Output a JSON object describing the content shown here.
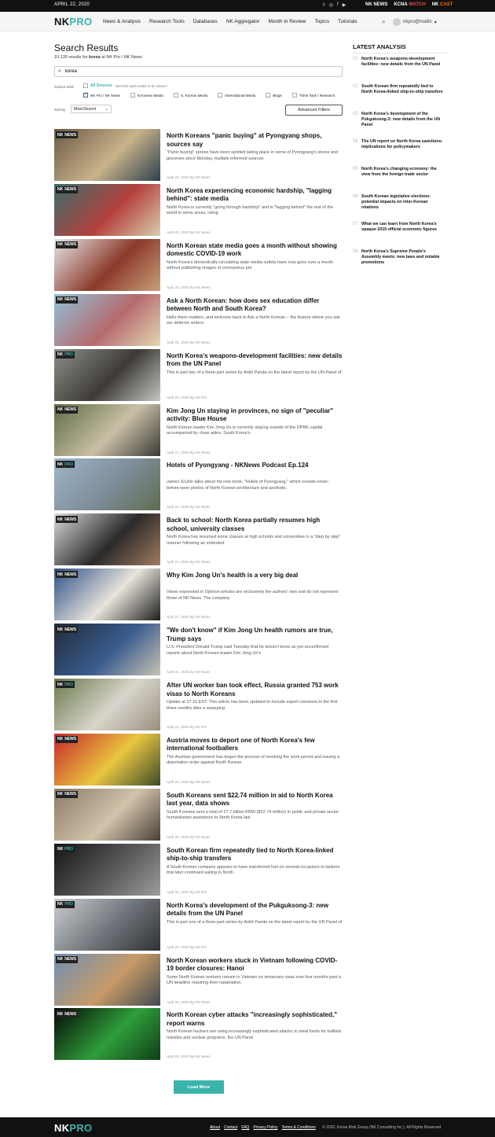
{
  "topbar": {
    "date": "APRIL 22, 2020",
    "social_icons": [
      "twitter-icon",
      "instagram-icon",
      "facebook-icon",
      "youtube-icon"
    ],
    "social_glyphs": [
      "𝕥",
      "◎",
      "f",
      "▶"
    ],
    "brands": [
      {
        "a": "NK",
        "b": " NEWS",
        "color": "#ffffff"
      },
      {
        "a": "KCNA ",
        "b": "WATCH",
        "color": "#e74c3c"
      },
      {
        "a": "NK ",
        "b": "CAST",
        "color": "#ff6a00"
      }
    ]
  },
  "nav": {
    "logo_nk": "NK",
    "logo_pro": "PRO",
    "items": [
      "News & Analysis",
      "Research Tools",
      "Databases",
      "NK Aggregator",
      "Month in Review",
      "Topics",
      "Tutorials"
    ],
    "username": "nkpro@mailin"
  },
  "search": {
    "title": "Search Results",
    "count": "10,130",
    "results_for": "results for",
    "query": "korea",
    "scope": "at NK Pro / NK News",
    "source_kind_label": "Source Kind",
    "all_sources": "All Sources",
    "note": "/ 664,901 total results to be shown /",
    "options": [
      {
        "label": "NK Pro / NK News",
        "checked": true
      },
      {
        "label": "N.Korean Media",
        "checked": false
      },
      {
        "label": "S. Korean Media",
        "checked": false
      },
      {
        "label": "International Media",
        "checked": false
      },
      {
        "label": "Blogs",
        "checked": false
      },
      {
        "label": "Think Tank / Research",
        "checked": false
      }
    ],
    "sort_label": "Sort by",
    "sort_value": "Most Recent",
    "advanced": "Advanced Filters"
  },
  "articles": [
    {
      "badge": "NEWS",
      "title": "North Koreans \"panic buying\" at Pyongyang shops, sources say",
      "excerpt": "\"Panic buying\" sprees have been spotted taking place in some of Pyongyang's stores and groceries since Monday, multiple informed sources",
      "meta": "April 22, 2020 By NK News",
      "colors": [
        "#6b5a45",
        "#c9b38a",
        "#2c3f4f"
      ]
    },
    {
      "badge": "NEWS",
      "title": "North Korea experiencing economic hardship, \"lagging behind\": state media",
      "excerpt": "North Korea is currently \"going through hardship\" and is \"lagging behind\" the rest of the world in some areas, ruling",
      "meta": "April 22, 2020 By NK News",
      "colors": [
        "#3a6e6a",
        "#b4413c",
        "#d9cfae"
      ]
    },
    {
      "badge": "NEWS",
      "title": "North Korean state media goes a month without showing domestic COVID-19 work",
      "excerpt": "North Korea's domestically-circulating state media outlets have now gone over a month without publishing images of coronavirus pre",
      "meta": "April 22, 2020 By NK News",
      "colors": [
        "#e7e7ea",
        "#8b3a2a",
        "#c7a07a"
      ]
    },
    {
      "badge": "NEWS",
      "title": "Ask a North Korean: how does sex education differ between North and South Korea?",
      "excerpt": "Hello there readers, and welcome back to Ask a North Korean -- the feature where you ask our defector writers",
      "meta": "April 22, 2020 By NK News",
      "colors": [
        "#8ec3d9",
        "#b56a6e",
        "#e3d7b0"
      ]
    },
    {
      "badge": "PRO",
      "title": "North Korea's weapons-development facilities: new details from the UN Panel",
      "excerpt": "This is part two of a three-part series by Ankit Panda on the latest report by the UN Panel of",
      "meta": "April 22, 2020 By NK Pro",
      "colors": [
        "#8c8f89",
        "#3e3b36",
        "#c4c6c0"
      ]
    },
    {
      "badge": "NEWS",
      "title": "Kim Jong Un staying in provinces, no sign of \"peculiar\" activity: Blue House",
      "excerpt": "North Korean leader Kim Jong Un is currently staying outside of the DPRK capital accompanied by close aides, South Korea's",
      "meta": "April 21, 2020 By NK News",
      "colors": [
        "#5d6b45",
        "#c9c0a6",
        "#3a3a35"
      ]
    },
    {
      "badge": "PRO",
      "title": "Hotels of Pyongyang - NKNews Podcast Ep.124",
      "excerpt": "James Scullin talks about his new book, \"Hotels of Pyongyang,\" which reveals never-before-seen photos of North Korean architecture and aesthetic.",
      "meta": "April 21, 2020 By NK News",
      "colors": [
        "#9fb5c9",
        "#7d8c98",
        "#5f6d4e"
      ]
    },
    {
      "badge": "NEWS",
      "title": "Back to school: North Korea partially resumes high school, university classes",
      "excerpt": "North Korea has resumed some classes at high schools and universities in a \"step by step\" manner following an extended",
      "meta": "April 21, 2020 By NK News",
      "colors": [
        "#d6d9dc",
        "#2a2a2a",
        "#a37b5e"
      ]
    },
    {
      "badge": "NEWS",
      "title": "Why Kim Jong Un's health is a very big deal",
      "excerpt": "Views expressed in Opinion articles are exclusively the authors' own and do not represent those of NK News. The company",
      "meta": "April 21, 2020 By NK News",
      "colors": [
        "#2d4f8a",
        "#e8e4da",
        "#1d1d1d"
      ]
    },
    {
      "badge": "NEWS",
      "title": "\"We don't know\" if Kim Jong Un health rumors are true, Trump says",
      "excerpt": "U.S. President Donald Trump said Tuesday that he doesn't know as-yet-unconfirmed reports about North Korean leader Kim Jong Un's",
      "meta": "April 21, 2020 By NK News",
      "colors": [
        "#1f2a3a",
        "#3b5d8e",
        "#c9c2b3"
      ]
    },
    {
      "badge": "PRO",
      "title": "After UN worker ban took effect, Russia granted 753 work visas to North Koreans",
      "excerpt": "Update at 17:15 EST: This article has been updated to include expert comment.In the first three months after a sweeping",
      "meta": "April 21, 2020 By NK Pro",
      "colors": [
        "#6b7a4c",
        "#d8d5cc",
        "#9a8f80"
      ]
    },
    {
      "badge": "NEWS",
      "title": "Austria moves to deport one of North Korea's few international footballers",
      "excerpt": "The Austrian government has begun the process of revoking the work permit and issuing a deportation order against North Korean",
      "meta": "April 20, 2020 By NK News",
      "colors": [
        "#c8262b",
        "#e8c640",
        "#3e4b2a"
      ]
    },
    {
      "badge": "NEWS",
      "title": "South Koreans sent $22.74 million in aid to North Korea last year, data shows",
      "excerpt": "South Koreans sent a total of 27.7 billion KRW ($22.74 million) in public and private sector humanitarian assistance to North Korea last",
      "meta": "April 20, 2020 By NK News",
      "colors": [
        "#8a7a66",
        "#d1c2aa",
        "#4a4036"
      ]
    },
    {
      "badge": "PRO",
      "title": "South Korean firm repeatedly tied to North Korea-linked ship-to-ship transfers",
      "excerpt": "A South Korean company appears to have transferred fuel on several occasions to tankers that later continued sailing to North",
      "meta": "April 20, 2020 By NK Pro",
      "colors": [
        "#141414",
        "#5a5a5a",
        "#9c9c9c"
      ]
    },
    {
      "badge": "PRO",
      "title": "North Korea's development of the Pukguksong-3: new details from the UN Panel",
      "excerpt": "This is part one of a three-part series by Ankit Panda on the latest report by the UN Panel of",
      "meta": "April 20, 2020 By NK Pro",
      "colors": [
        "#c9cdd1",
        "#6d7378",
        "#2e3236"
      ]
    },
    {
      "badge": "NEWS",
      "title": "North Korean workers stuck in Vietnam following COVID-19 border closures: Hanoi",
      "excerpt": "Some North Korean workers remain in Vietnam on temporary visas now four months past a UN deadline requiring their repatriation,",
      "meta": "April 20, 2020 By NK News",
      "colors": [
        "#6e8fb5",
        "#c79a67",
        "#3f4a52"
      ]
    },
    {
      "badge": "NEWS",
      "title": "North Korean cyber attacks \"increasingly sophisticated,\" report warns",
      "excerpt": "North Korean hackers are using increasingly sophisticated attacks to steal funds for ballistic missiles and nuclear programs, the UN Panel",
      "meta": "April 18, 2020 By NK News",
      "colors": [
        "#050a05",
        "#2f9e3a",
        "#0f3d15"
      ]
    }
  ],
  "sidebar": {
    "title": "LATEST ANALYSIS",
    "items": [
      {
        "num": "01",
        "text": "North Korea's weapons-development facilities: new details from the UN Panel"
      },
      {
        "num": "02",
        "text": "South Korean firm repeatedly tied to North Korea-linked ship-to-ship transfers"
      },
      {
        "num": "03",
        "text": "North Korea's development of the Pukguksong-3: new details from the UN Panel"
      },
      {
        "num": "04",
        "text": "The UN report on North Korea sanctions: implications for policymakers"
      },
      {
        "num": "05",
        "text": "North Korea's changing economy: the view from the foreign trade sector"
      },
      {
        "num": "06",
        "text": "South Korean legislative elections: potential impacts on inter-Korean relations"
      },
      {
        "num": "07",
        "text": "What we can learn from North Korea's opaque 2019 official economic figures"
      },
      {
        "num": "08",
        "text": "North Korea's Supreme People's Assembly meets: new laws and notable promotions"
      }
    ]
  },
  "load_more": "Load More",
  "footer": {
    "links": [
      "About",
      "Contact",
      "FAQ",
      "Privacy Policy",
      "Terms & Conditions"
    ],
    "copyright": "© 2020, Korea Risk Group (NK Consulting Inc.). All Rights Reserved"
  }
}
